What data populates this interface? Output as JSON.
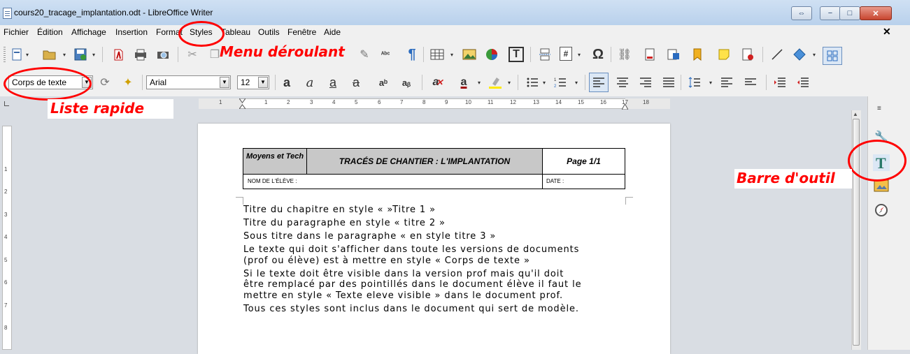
{
  "window": {
    "title": "cours20_tracage_implantation.odt - LibreOffice Writer",
    "controls": {
      "restore_app": "⇔",
      "minimize": "−",
      "maximize": "□",
      "close": "✕"
    }
  },
  "menubar": {
    "items": [
      "Fichier",
      "Édition",
      "Affichage",
      "Insertion",
      "Format",
      "Styles",
      "Tableau",
      "Outils",
      "Fenêtre",
      "Aide"
    ],
    "close_doc": "✕"
  },
  "formatting": {
    "paragraph_style": "Corps de texte",
    "font_name": "Arial",
    "font_size": "12"
  },
  "ruler": {
    "numbers": [
      "1",
      "1",
      "2",
      "3",
      "4",
      "5",
      "6",
      "7",
      "8",
      "9",
      "10",
      "11",
      "12",
      "13",
      "14",
      "15",
      "16",
      "17",
      "18"
    ],
    "vertical_numbers": [
      "1",
      "2",
      "3",
      "4",
      "5",
      "6",
      "7",
      "8"
    ]
  },
  "document": {
    "header": {
      "subject": "Moyens et Tech",
      "title": "TRACÉS DE CHANTIER : L'IMPLANTATION",
      "page": "Page 1/1",
      "student_name_label": "NOM DE L'ÉLÈVE :",
      "date_label": "DATE :"
    },
    "paragraphs": [
      "Titre du chapitre en style « »Titre 1 »",
      "Titre du paragraphe en style « titre 2 »",
      "Sous titre dans le paragraphe « en style titre 3 »",
      "Le texte qui doit s'afficher dans toute les versions de documents",
      "(prof ou élève) est à mettre en style « Corps de texte »",
      "Si le texte doit être visible dans la version prof mais qu'il doit",
      "être remplacé par des pointillés dans le document élève il faut le",
      "mettre en style « Texte eleve visible » dans le document prof.",
      "Tous ces styles sont inclus dans le document qui sert de modèle."
    ]
  },
  "annotations": {
    "menu": "Menu déroulant",
    "quick_list": "Liste rapide",
    "toolbar": "Barre d'outil"
  },
  "colors": {
    "annotation": "#ff0000",
    "table_shade": "#c8c8c8"
  }
}
